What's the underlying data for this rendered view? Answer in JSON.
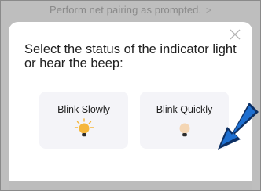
{
  "background": {
    "prompt_text": "Perform net pairing as prompted.",
    "chevron": ">"
  },
  "dialog": {
    "title": "Select the status of the indicator light or hear the beep:",
    "close_icon": "close-icon",
    "options": [
      {
        "label": "Blink Slowly",
        "icon": "bulb-lit-icon"
      },
      {
        "label": "Blink Quickly",
        "icon": "bulb-dim-icon"
      }
    ]
  },
  "annotation": {
    "arrow_icon": "pointer-arrow-icon",
    "arrow_color": "#1e6fd0"
  },
  "colors": {
    "overlay": "#bebebe",
    "bulb_lit": "#f5b63c",
    "bulb_dim": "#f4d6b4",
    "option_bg": "#f4f4f8"
  }
}
